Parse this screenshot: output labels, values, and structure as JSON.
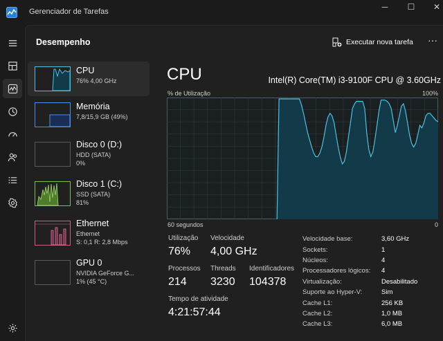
{
  "app": {
    "title": "Gerenciador de Tarefas",
    "window_buttons": {
      "minimize": "─",
      "maximize": "☐",
      "close": "✕"
    }
  },
  "nav": {
    "items": [
      {
        "icon": "hamburger-menu-icon"
      },
      {
        "icon": "processes-icon"
      },
      {
        "icon": "performance-icon",
        "active": true
      },
      {
        "icon": "app-history-icon"
      },
      {
        "icon": "startup-apps-icon"
      },
      {
        "icon": "users-icon"
      },
      {
        "icon": "details-icon"
      },
      {
        "icon": "services-icon"
      },
      {
        "icon": "settings-icon"
      }
    ]
  },
  "header": {
    "title": "Desempenho",
    "run_task_label": "Executar nova tarefa",
    "more_label": "···"
  },
  "resources": [
    {
      "name": "CPU",
      "line1": "76% 4,00 GHz",
      "line2": "",
      "color": "#4cc2e0",
      "active": true
    },
    {
      "name": "Memória",
      "line1": "7,8/15,9 GB (49%)",
      "line2": "",
      "color": "#4e8cf0",
      "active": false
    },
    {
      "name": "Disco 0 (D:)",
      "line1": "HDD (SATA)",
      "line2": "0%",
      "color": "#7cc04a",
      "active": false
    },
    {
      "name": "Disco 1 (C:)",
      "line1": "SSD (SATA)",
      "line2": "81%",
      "color": "#7cc04a",
      "active": false
    },
    {
      "name": "Ethernet",
      "line1": "Ethernet",
      "line2": "S: 0,1 R: 2,8 Mbps",
      "color": "#d06088",
      "active": false
    },
    {
      "name": "GPU 0",
      "line1": "NVIDIA GeForce G...",
      "line2": "1% (45 °C)",
      "color": "#4cc2e0",
      "active": false
    }
  ],
  "detail": {
    "title": "CPU",
    "model": "Intel(R) Core(TM) i3-9100F CPU @ 3.60GHz",
    "util_label": "% de Utilização",
    "util_max": "100%",
    "time_left": "60 segundos",
    "time_right": "0",
    "stats": {
      "utilizacao_label": "Utilização",
      "utilizacao_value": "76%",
      "velocidade_label": "Velocidade",
      "velocidade_value": "4,00 GHz",
      "processos_label": "Processos",
      "processos_value": "214",
      "threads_label": "Threads",
      "threads_value": "3230",
      "identificadores_label": "Identificadores",
      "identificadores_value": "104378",
      "tempo_label": "Tempo de atividade",
      "tempo_value": "4:21:57:44"
    },
    "info": [
      {
        "k": "Velocidade base:",
        "v": "3,60 GHz"
      },
      {
        "k": "Sockets:",
        "v": "1"
      },
      {
        "k": "Núcleos:",
        "v": "4"
      },
      {
        "k": "Processadores lógicos:",
        "v": "4"
      },
      {
        "k": "Virtualização:",
        "v": "Desabilitado"
      },
      {
        "k": "Suporte ao Hyper-V:",
        "v": "Sim"
      },
      {
        "k": "Cache L1:",
        "v": "256 KB"
      },
      {
        "k": "Cache L2:",
        "v": "1,0 MB"
      },
      {
        "k": "Cache L3:",
        "v": "6,0 MB"
      }
    ],
    "graph_series": [
      0,
      0,
      0,
      0,
      0,
      0,
      0,
      0,
      0,
      0,
      0,
      0,
      0,
      0,
      0,
      0,
      0,
      0,
      0,
      0,
      0,
      0,
      0,
      0,
      0,
      0,
      0,
      0,
      0,
      0,
      0,
      0,
      0,
      0,
      0,
      0,
      0,
      0,
      0,
      0,
      0,
      0,
      0,
      0,
      0,
      0,
      0,
      0,
      0,
      0,
      0,
      0,
      0,
      0,
      0,
      100,
      100,
      100,
      100,
      100,
      100,
      100,
      100,
      100,
      100,
      100,
      95,
      88,
      80,
      72,
      66,
      60,
      55,
      52,
      52,
      55,
      60,
      68,
      78,
      85,
      88,
      86,
      80,
      70,
      60,
      52,
      46,
      48,
      56,
      68,
      80,
      92,
      96,
      98,
      98,
      98,
      98,
      92,
      72,
      58,
      52,
      56,
      66,
      78,
      90,
      99,
      99,
      99,
      98,
      96,
      92,
      82,
      72,
      78,
      86,
      94,
      96,
      90,
      80,
      70,
      63,
      60,
      63,
      70,
      78,
      76,
      80,
      86,
      88,
      88,
      86,
      84,
      82,
      81
    ],
    "graph_colors": {
      "line": "#4cc2e0",
      "fill": "#133a49",
      "grid": "#2e3a3e",
      "border": "#4a5d63",
      "bg": "#1a1f21"
    }
  }
}
